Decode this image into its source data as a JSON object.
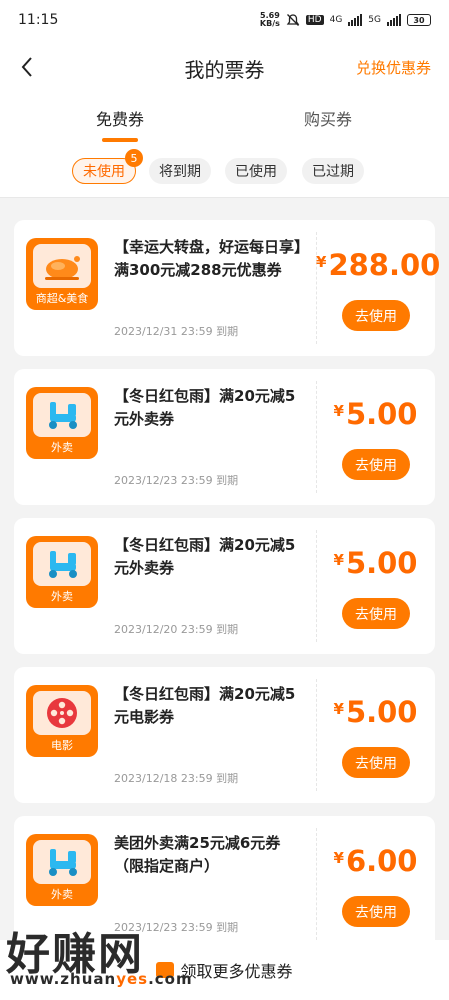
{
  "status_bar": {
    "time": "11:15",
    "net_speed": "5.69",
    "net_unit": "KB/s",
    "hd": "HD",
    "sig1": "4G",
    "sig2": "5G",
    "battery": "30"
  },
  "header": {
    "title": "我的票券",
    "redeem_link": "兑换优惠券"
  },
  "tabs": [
    {
      "label": "免费券",
      "active": true
    },
    {
      "label": "购买券",
      "active": false
    }
  ],
  "filters": [
    {
      "label": "未使用",
      "active": true,
      "badge": "5"
    },
    {
      "label": "将到期",
      "active": false
    },
    {
      "label": "已使用",
      "active": false
    },
    {
      "label": "已过期",
      "active": false
    }
  ],
  "coupons": [
    {
      "icon": "roast-chicken-icon",
      "icon_label": "商超&美食",
      "title": "【幸运大转盘，好运每日享】满300元减288元优惠券",
      "currency": "¥",
      "amount": "288.00",
      "expiry": "2023/12/31 23:59 到期",
      "button": "去使用"
    },
    {
      "icon": "scooter-icon",
      "icon_label": "外卖",
      "title": "【冬日红包雨】满20元减5元外卖券",
      "currency": "¥",
      "amount": "5.00",
      "expiry": "2023/12/23 23:59 到期",
      "button": "去使用"
    },
    {
      "icon": "scooter-icon",
      "icon_label": "外卖",
      "title": "【冬日红包雨】满20元减5元外卖券",
      "currency": "¥",
      "amount": "5.00",
      "expiry": "2023/12/20 23:59 到期",
      "button": "去使用"
    },
    {
      "icon": "film-reel-icon",
      "icon_label": "电影",
      "title": "【冬日红包雨】满20元减5元电影券",
      "currency": "¥",
      "amount": "5.00",
      "expiry": "2023/12/18 23:59 到期",
      "button": "去使用"
    },
    {
      "icon": "scooter-icon",
      "icon_label": "外卖",
      "title": "美团外卖满25元减6元券（限指定商户）",
      "currency": "¥",
      "amount": "6.00",
      "expiry": "2023/12/23 23:59 到期",
      "button": "去使用"
    }
  ],
  "bottom": {
    "more_label": "领取更多优惠券"
  },
  "watermark": {
    "main": "好赚网",
    "sub_prefix": "www.zhuan",
    "sub_accent": "yes",
    "sub_suffix": ".com"
  },
  "colors": {
    "accent": "#ff7a00",
    "price": "#ff6a00",
    "background": "#f3f3f3"
  }
}
